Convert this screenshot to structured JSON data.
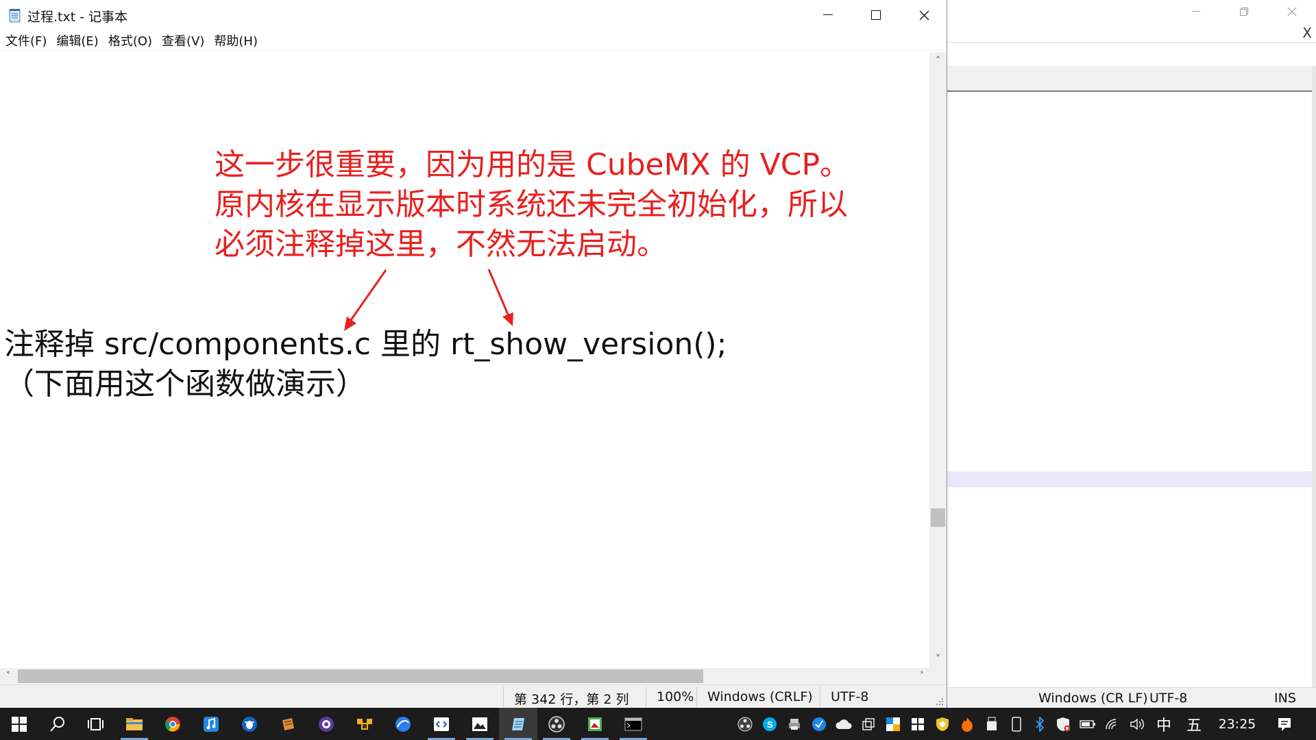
{
  "background_window": {
    "close_label": "X",
    "status": {
      "line_ending": "Windows (CR LF)",
      "encoding": "UTF-8",
      "mode": "INS"
    }
  },
  "notepad": {
    "title": "过程.txt - 记事本",
    "menu": [
      "文件(F)",
      "编辑(E)",
      "格式(O)",
      "查看(V)",
      "帮助(H)"
    ],
    "annotation_lines": [
      "这一步很重要，因为用的是 CubeMX 的 VCP。",
      "原内核在显示版本时系统还未完全初始化，所以",
      "必须注释掉这里，不然无法启动。"
    ],
    "text_lines": [
      "注释掉  src/components.c 里的 rt_show_version();",
      "（下面用这个函数做演示）"
    ],
    "status": {
      "position": "第 342 行，第 2 列",
      "zoom": "100%",
      "line_ending": "Windows (CRLF)",
      "encoding": "UTF-8"
    }
  },
  "taskbar": {
    "ime_lang": "中",
    "ime_mode": "五",
    "clock": "23:25"
  },
  "colors": {
    "annotation": "#e8201f",
    "taskbar": "#1c1c1c"
  }
}
